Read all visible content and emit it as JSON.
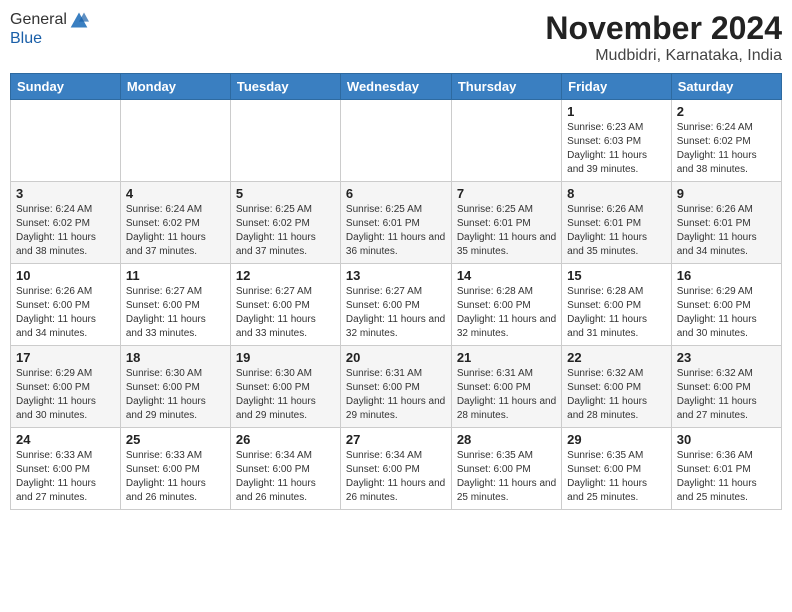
{
  "logo": {
    "general": "General",
    "blue": "Blue"
  },
  "title": "November 2024",
  "location": "Mudbidri, Karnataka, India",
  "weekdays": [
    "Sunday",
    "Monday",
    "Tuesday",
    "Wednesday",
    "Thursday",
    "Friday",
    "Saturday"
  ],
  "weeks": [
    [
      {
        "day": "",
        "info": ""
      },
      {
        "day": "",
        "info": ""
      },
      {
        "day": "",
        "info": ""
      },
      {
        "day": "",
        "info": ""
      },
      {
        "day": "",
        "info": ""
      },
      {
        "day": "1",
        "info": "Sunrise: 6:23 AM\nSunset: 6:03 PM\nDaylight: 11 hours and 39 minutes."
      },
      {
        "day": "2",
        "info": "Sunrise: 6:24 AM\nSunset: 6:02 PM\nDaylight: 11 hours and 38 minutes."
      }
    ],
    [
      {
        "day": "3",
        "info": "Sunrise: 6:24 AM\nSunset: 6:02 PM\nDaylight: 11 hours and 38 minutes."
      },
      {
        "day": "4",
        "info": "Sunrise: 6:24 AM\nSunset: 6:02 PM\nDaylight: 11 hours and 37 minutes."
      },
      {
        "day": "5",
        "info": "Sunrise: 6:25 AM\nSunset: 6:02 PM\nDaylight: 11 hours and 37 minutes."
      },
      {
        "day": "6",
        "info": "Sunrise: 6:25 AM\nSunset: 6:01 PM\nDaylight: 11 hours and 36 minutes."
      },
      {
        "day": "7",
        "info": "Sunrise: 6:25 AM\nSunset: 6:01 PM\nDaylight: 11 hours and 35 minutes."
      },
      {
        "day": "8",
        "info": "Sunrise: 6:26 AM\nSunset: 6:01 PM\nDaylight: 11 hours and 35 minutes."
      },
      {
        "day": "9",
        "info": "Sunrise: 6:26 AM\nSunset: 6:01 PM\nDaylight: 11 hours and 34 minutes."
      }
    ],
    [
      {
        "day": "10",
        "info": "Sunrise: 6:26 AM\nSunset: 6:00 PM\nDaylight: 11 hours and 34 minutes."
      },
      {
        "day": "11",
        "info": "Sunrise: 6:27 AM\nSunset: 6:00 PM\nDaylight: 11 hours and 33 minutes."
      },
      {
        "day": "12",
        "info": "Sunrise: 6:27 AM\nSunset: 6:00 PM\nDaylight: 11 hours and 33 minutes."
      },
      {
        "day": "13",
        "info": "Sunrise: 6:27 AM\nSunset: 6:00 PM\nDaylight: 11 hours and 32 minutes."
      },
      {
        "day": "14",
        "info": "Sunrise: 6:28 AM\nSunset: 6:00 PM\nDaylight: 11 hours and 32 minutes."
      },
      {
        "day": "15",
        "info": "Sunrise: 6:28 AM\nSunset: 6:00 PM\nDaylight: 11 hours and 31 minutes."
      },
      {
        "day": "16",
        "info": "Sunrise: 6:29 AM\nSunset: 6:00 PM\nDaylight: 11 hours and 30 minutes."
      }
    ],
    [
      {
        "day": "17",
        "info": "Sunrise: 6:29 AM\nSunset: 6:00 PM\nDaylight: 11 hours and 30 minutes."
      },
      {
        "day": "18",
        "info": "Sunrise: 6:30 AM\nSunset: 6:00 PM\nDaylight: 11 hours and 29 minutes."
      },
      {
        "day": "19",
        "info": "Sunrise: 6:30 AM\nSunset: 6:00 PM\nDaylight: 11 hours and 29 minutes."
      },
      {
        "day": "20",
        "info": "Sunrise: 6:31 AM\nSunset: 6:00 PM\nDaylight: 11 hours and 29 minutes."
      },
      {
        "day": "21",
        "info": "Sunrise: 6:31 AM\nSunset: 6:00 PM\nDaylight: 11 hours and 28 minutes."
      },
      {
        "day": "22",
        "info": "Sunrise: 6:32 AM\nSunset: 6:00 PM\nDaylight: 11 hours and 28 minutes."
      },
      {
        "day": "23",
        "info": "Sunrise: 6:32 AM\nSunset: 6:00 PM\nDaylight: 11 hours and 27 minutes."
      }
    ],
    [
      {
        "day": "24",
        "info": "Sunrise: 6:33 AM\nSunset: 6:00 PM\nDaylight: 11 hours and 27 minutes."
      },
      {
        "day": "25",
        "info": "Sunrise: 6:33 AM\nSunset: 6:00 PM\nDaylight: 11 hours and 26 minutes."
      },
      {
        "day": "26",
        "info": "Sunrise: 6:34 AM\nSunset: 6:00 PM\nDaylight: 11 hours and 26 minutes."
      },
      {
        "day": "27",
        "info": "Sunrise: 6:34 AM\nSunset: 6:00 PM\nDaylight: 11 hours and 26 minutes."
      },
      {
        "day": "28",
        "info": "Sunrise: 6:35 AM\nSunset: 6:00 PM\nDaylight: 11 hours and 25 minutes."
      },
      {
        "day": "29",
        "info": "Sunrise: 6:35 AM\nSunset: 6:00 PM\nDaylight: 11 hours and 25 minutes."
      },
      {
        "day": "30",
        "info": "Sunrise: 6:36 AM\nSunset: 6:01 PM\nDaylight: 11 hours and 25 minutes."
      }
    ]
  ]
}
